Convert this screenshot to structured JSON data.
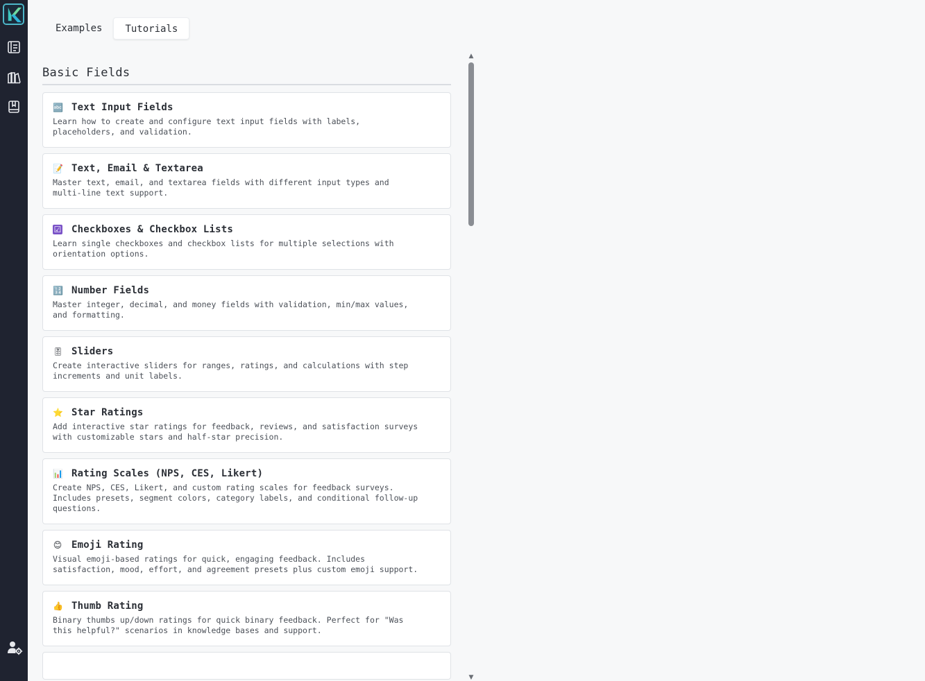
{
  "app": {
    "accent": "#4db6c8",
    "rail_bg": "#1f2330"
  },
  "rail": {
    "items": [
      {
        "name": "forms-icon"
      },
      {
        "name": "library-icon"
      },
      {
        "name": "book-icon"
      }
    ],
    "bottom_icon": "user-settings-icon"
  },
  "tabs": [
    {
      "label": "Examples",
      "active": false
    },
    {
      "label": "Tutorials",
      "active": true
    }
  ],
  "section": {
    "title": "Basic Fields"
  },
  "cards": [
    {
      "icon": "abc-icon",
      "glyph": "🔤",
      "title": "Text Input Fields",
      "description": "Learn how to create and configure text input fields with labels, placeholders, and validation."
    },
    {
      "icon": "memo-icon",
      "glyph": "📝",
      "title": "Text, Email & Textarea",
      "description": "Master text, email, and textarea fields with different input types and multi-line text support."
    },
    {
      "icon": "checkbox-icon",
      "glyph": "☑",
      "title": "Checkboxes & Checkbox Lists",
      "description": "Learn single checkboxes and checkbox lists for multiple selections with orientation options."
    },
    {
      "icon": "numbers-icon",
      "glyph": "🔢",
      "title": "Number Fields",
      "description": "Master integer, decimal, and money fields with validation, min/max values, and formatting."
    },
    {
      "icon": "slider-icon",
      "glyph": "🎚",
      "title": "Sliders",
      "description": "Create interactive sliders for ranges, ratings, and calculations with step increments and unit labels."
    },
    {
      "icon": "star-icon",
      "glyph": "⭐",
      "title": "Star Ratings",
      "description": "Add interactive star ratings for feedback, reviews, and satisfaction surveys with customizable stars and half-star precision."
    },
    {
      "icon": "bar-chart-icon",
      "glyph": "📊",
      "title": "Rating Scales (NPS, CES, Likert)",
      "description": "Create NPS, CES, Likert, and custom rating scales for feedback surveys. Includes presets, segment colors, category labels, and conditional follow-up questions."
    },
    {
      "icon": "smile-icon",
      "glyph": "😊",
      "title": "Emoji Rating",
      "description": "Visual emoji-based ratings for quick, engaging feedback. Includes satisfaction, mood, effort, and agreement presets plus custom emoji support."
    },
    {
      "icon": "thumbs-up-icon",
      "glyph": "👍",
      "title": "Thumb Rating",
      "description": "Binary thumbs up/down ratings for quick binary feedback. Perfect for \"Was this helpful?\" scenarios in knowledge bases and support."
    }
  ]
}
